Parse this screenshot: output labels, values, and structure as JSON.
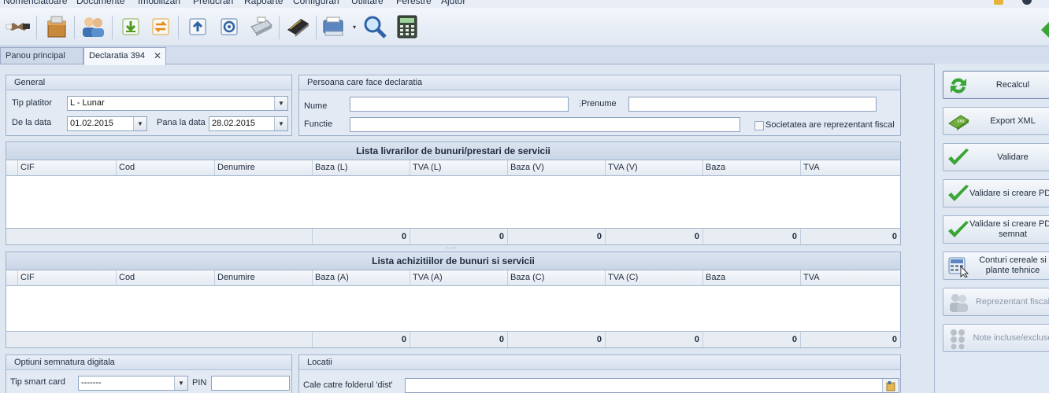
{
  "menu": [
    "Nomenclatoare",
    "Documente",
    "Imobilizari",
    "Prelucrari",
    "Rapoarte",
    "Configurari",
    "Utilitare",
    "Ferestre",
    "Ajutor"
  ],
  "toolbar": {
    "icons": [
      "handshake-icon",
      "package-icon",
      "users-icon",
      "import-icon",
      "transfer-icon",
      "upload-icon",
      "settings-doc-icon",
      "cash-register-icon",
      "book-icon",
      "printer-icon",
      "zoom-icon",
      "calculator-icon"
    ]
  },
  "tabs": [
    {
      "label": "Panou principal"
    },
    {
      "label": "Declaratia 394",
      "close": "✕"
    }
  ],
  "general": {
    "title": "General",
    "tip_platitor_label": "Tip platitor",
    "tip_platitor_value": "L - Lunar",
    "de_la_data_label": "De la data",
    "de_la_data_value": "01.02.2015",
    "pana_la_data_label": "Pana la data",
    "pana_la_data_value": "28.02.2015"
  },
  "persoana": {
    "title": "Persoana care face declaratia",
    "nume_label": "Nume",
    "nume_value": "",
    "prenume_label": "Prenume",
    "prenume_value": "",
    "functie_label": "Functie",
    "functie_value": "",
    "reprezentant_label": "Societatea are reprezentant fiscal"
  },
  "livrari": {
    "title": "Lista livrarilor de bunuri/prestari de servicii",
    "columns": [
      "CIF",
      "Cod",
      "Denumire",
      "Baza (L)",
      "TVA (L)",
      "Baza (V)",
      "TVA (V)",
      "Baza",
      "TVA"
    ],
    "totals": [
      "0",
      "0",
      "0",
      "0",
      "0",
      "0"
    ]
  },
  "splitter": "....",
  "achizitii": {
    "title": "Lista achizitiilor de bunuri si servicii",
    "columns": [
      "CIF",
      "Cod",
      "Denumire",
      "Baza (A)",
      "TVA (A)",
      "Baza (C)",
      "TVA (C)",
      "Baza",
      "TVA"
    ],
    "totals": [
      "0",
      "0",
      "0",
      "0",
      "0",
      "0"
    ]
  },
  "semnatura": {
    "title": "Optiuni semnatura digitala",
    "smart_card_label": "Tip smart card",
    "smart_card_value": "-------",
    "pin_label": "PIN",
    "pin_value": ""
  },
  "locatii": {
    "title": "Locatii",
    "folder_label": "Cale catre folderul 'dist'",
    "folder_value": ""
  },
  "actions": [
    {
      "label": "Recalcul",
      "icon": "refresh-icon",
      "enabled": true
    },
    {
      "label": "Export XML",
      "icon": "xml-export-icon",
      "enabled": true
    },
    {
      "label": "Validare",
      "icon": "checkmark-icon",
      "enabled": true
    },
    {
      "label": "Validare si creare PDF",
      "icon": "checkmark-icon",
      "enabled": true
    },
    {
      "label": "Validare si creare PDF\nsemnat",
      "icon": "checkmark-icon",
      "enabled": true
    },
    {
      "label": "Conturi cereale si\nplante tehnice",
      "icon": "calculator-cursor-icon",
      "enabled": true
    },
    {
      "label": "Reprezentant fiscal",
      "icon": "users-icon",
      "enabled": false
    },
    {
      "label": "Note incluse/excluse",
      "icon": "notes-icon",
      "enabled": false
    }
  ],
  "colors": {
    "accent": "#3c6ea8",
    "check_green": "#3aa535",
    "background": "#dde6f1"
  }
}
